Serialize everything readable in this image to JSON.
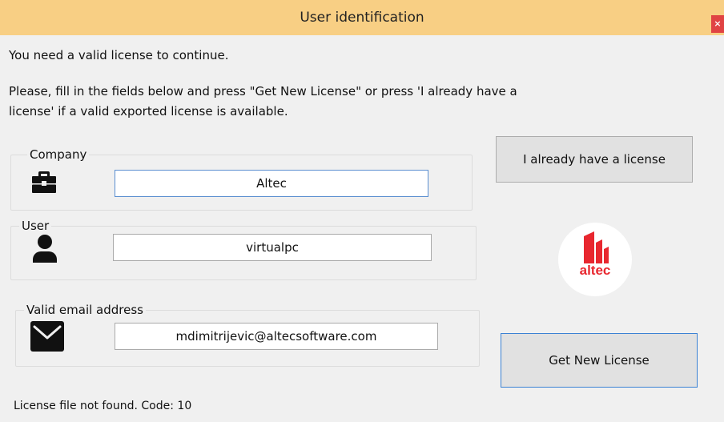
{
  "window": {
    "title": "User identification",
    "close_glyph": "×"
  },
  "messages": {
    "line1": "You need a valid license to continue.",
    "line2": "Please, fill in the fields below and press \"Get New License\" or press 'I already have a",
    "line3": "license' if  a valid exported license is available."
  },
  "company": {
    "label": "Company",
    "value": "Altec",
    "icon": "briefcase-icon"
  },
  "user": {
    "label": "User",
    "value": "virtualpc",
    "icon": "user-icon"
  },
  "email": {
    "label": "Valid email address",
    "value": "mdimitrijevic@altecsoftware.com",
    "icon": "envelope-icon"
  },
  "buttons": {
    "already_have": "I already have a license",
    "get_new": "Get New License"
  },
  "logo": {
    "text": "altec",
    "brand_color": "#e8272f"
  },
  "status": {
    "text": "License file not found. Code: 10"
  }
}
